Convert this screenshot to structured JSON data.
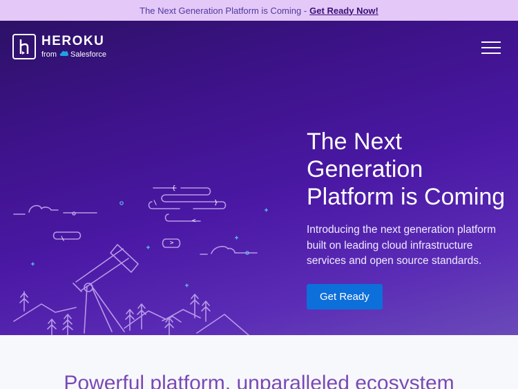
{
  "announcement": {
    "text": "The Next Generation Platform is Coming -",
    "link": "Get Ready Now!"
  },
  "header": {
    "brand": "HEROKU",
    "from_prefix": "from",
    "from_company": "Salesforce",
    "menu_icon": "hamburger-menu-icon"
  },
  "hero": {
    "title": "The Next Generation Platform is Coming",
    "subtitle": "Introducing the next generation platform built on leading cloud infrastructure services and open source standards.",
    "cta": "Get Ready",
    "illustration_icon": "telescope-landscape-icon"
  },
  "section": {
    "title": "Powerful platform, unparalleled ecosystem"
  },
  "colors": {
    "banner_bg": "#e4c8f7",
    "hero_start": "#2c1166",
    "hero_end": "#6a4ab8",
    "cta_bg": "#0d6fd9",
    "section_title": "#7a49b5"
  }
}
